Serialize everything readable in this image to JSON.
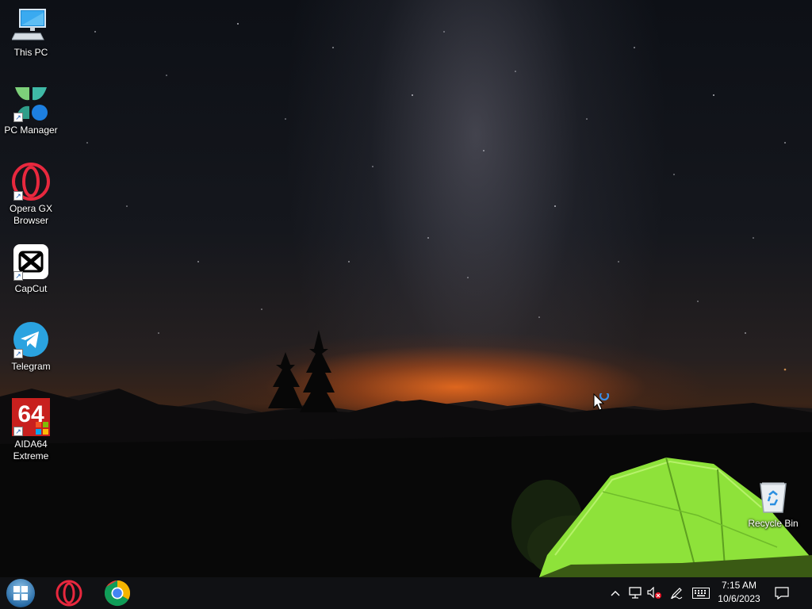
{
  "desktop": {
    "icons": [
      {
        "label": "This PC",
        "icon": "computer-icon"
      },
      {
        "label": "PC Manager",
        "icon": "pc-manager-icon"
      },
      {
        "label": "Opera GX Browser",
        "icon": "opera-gx-icon"
      },
      {
        "label": "CapCut",
        "icon": "capcut-icon"
      },
      {
        "label": "Telegram",
        "icon": "telegram-icon"
      },
      {
        "label": "AIDA64 Extreme",
        "icon": "aida64-icon",
        "badge": "64"
      },
      {
        "label": "Recycle Bin",
        "icon": "recycle-bin-icon"
      }
    ]
  },
  "taskbar": {
    "pinned": [
      {
        "name": "Start",
        "icon": "windows-start-icon"
      },
      {
        "name": "Opera GX",
        "icon": "opera-icon"
      },
      {
        "name": "Google Chrome",
        "icon": "chrome-icon"
      }
    ],
    "tray": {
      "icons": [
        "chevron-up-icon",
        "network-icon",
        "volume-muted-icon",
        "pen-icon",
        "keyboard-icon",
        "notification-icon"
      ],
      "time": "7:15 AM",
      "date": "10/6/2023"
    }
  },
  "colors": {
    "taskbar_bg": "#101114",
    "tent_green": "#8ee23a",
    "horizon_glow": "#e8692a"
  }
}
